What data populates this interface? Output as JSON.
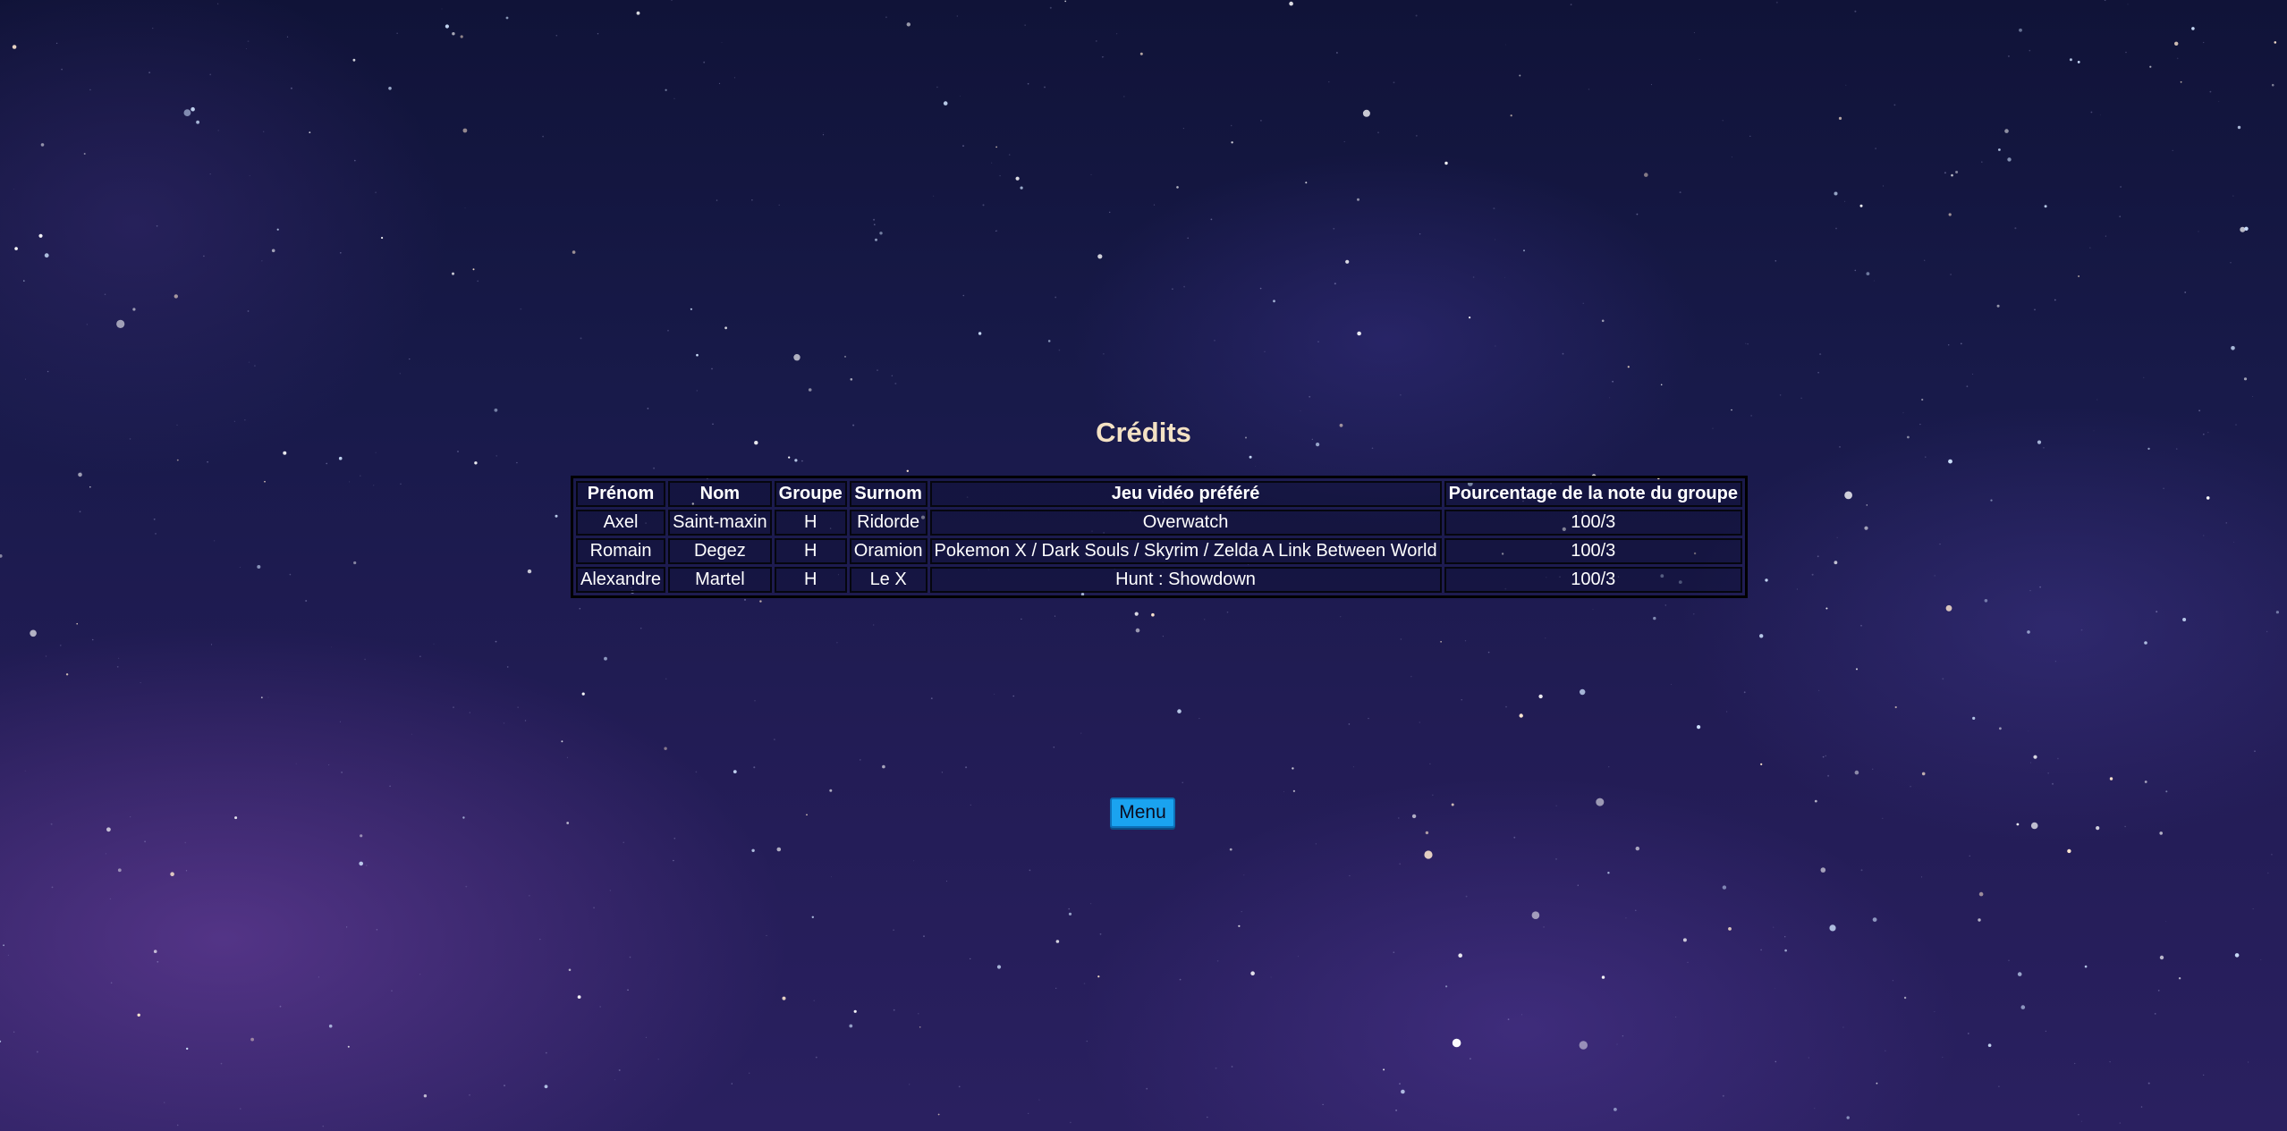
{
  "page": {
    "title": "Crédits"
  },
  "credits_table": {
    "headers": [
      "Prénom",
      "Nom",
      "Groupe",
      "Surnom",
      "Jeu vidéo préféré",
      "Pourcentage de la note du groupe"
    ],
    "rows": [
      [
        "Axel",
        "Saint-maxin",
        "H",
        "Ridorde",
        "Overwatch",
        "100/3"
      ],
      [
        "Romain",
        "Degez",
        "H",
        "Oramion",
        "Pokemon X / Dark Souls / Skyrim / Zelda A Link Between World",
        "100/3"
      ],
      [
        "Alexandre",
        "Martel",
        "H",
        "Le X",
        "Hunt : Showdown",
        "100/3"
      ]
    ]
  },
  "menu": {
    "label": "Menu"
  },
  "colors": {
    "background": "#181a4a",
    "title_text": "#f4e2c4",
    "button_bg": "#1aa3f0",
    "table_border": "#000000"
  }
}
